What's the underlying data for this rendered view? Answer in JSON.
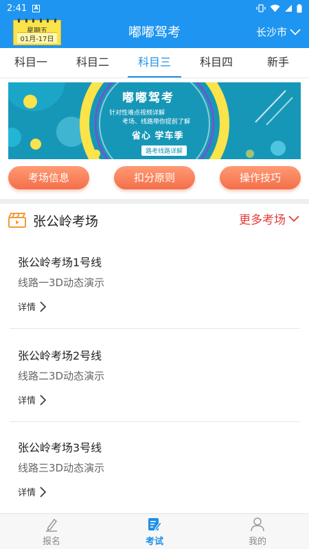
{
  "status_bar": {
    "time": "2:41",
    "notif_glyph": "A"
  },
  "header": {
    "calendar": {
      "weekday": "星期五",
      "date": "01月-17日"
    },
    "title": "嘟嘟驾考",
    "city": "长沙市"
  },
  "tabs": [
    {
      "label": "科目一",
      "active": false
    },
    {
      "label": "科目二",
      "active": false
    },
    {
      "label": "科目三",
      "active": true
    },
    {
      "label": "科目四",
      "active": false
    },
    {
      "label": "新手",
      "active": false
    }
  ],
  "banner": {
    "title": "嘟嘟驾考",
    "line1": "针对性难点视频详解",
    "line2": "考场、线路带你提前了解",
    "line3": "省心 学车季",
    "tag": "路考线路详解"
  },
  "quick_buttons": [
    "考场信息",
    "扣分原则",
    "操作技巧"
  ],
  "section": {
    "title": "张公岭考场",
    "more": "更多考场"
  },
  "routes": [
    {
      "title": "张公岭考场1号线",
      "subtitle": "线路一3D动态演示",
      "detail": "详情"
    },
    {
      "title": "张公岭考场2号线",
      "subtitle": "线路二3D动态演示",
      "detail": "详情"
    },
    {
      "title": "张公岭考场3号线",
      "subtitle": "线路三3D动态演示",
      "detail": "详情"
    }
  ],
  "bottom_nav": [
    {
      "label": "报名",
      "icon": "pen-icon",
      "active": false
    },
    {
      "label": "考试",
      "icon": "exam-edit-icon",
      "active": true
    },
    {
      "label": "我的",
      "icon": "person-icon",
      "active": false
    }
  ],
  "colors": {
    "primary": "#1e95f0",
    "accent_red": "#e8393a",
    "pill": "#f36f4a",
    "banner_bg": "#1797b8"
  }
}
